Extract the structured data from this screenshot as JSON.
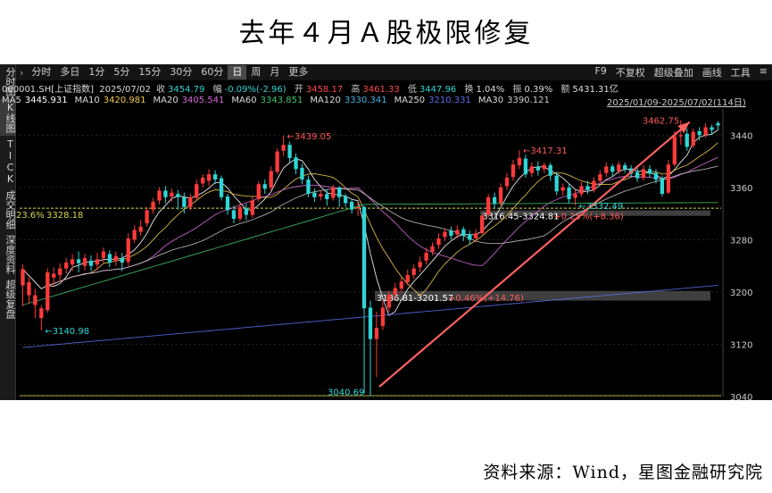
{
  "page": {
    "title": "去年４月Ａ股极限修复",
    "source": "资料来源：Wind，星图金融研究院"
  },
  "sidebar": {
    "items": [
      {
        "label": "分时图",
        "active": false
      },
      {
        "label": "K线图",
        "active": true
      },
      {
        "label": "TICK",
        "active": false
      },
      {
        "label": "成交明细",
        "active": false
      },
      {
        "label": "深度资料",
        "active": false
      },
      {
        "label": "超级复盘",
        "active": false
      }
    ]
  },
  "toolbar": {
    "arrow": "›",
    "periods": [
      {
        "label": "分时",
        "active": false
      },
      {
        "label": "多日",
        "active": false
      },
      {
        "label": "1分",
        "active": false
      },
      {
        "label": "5分",
        "active": false
      },
      {
        "label": "15分",
        "active": false
      },
      {
        "label": "30分",
        "active": false
      },
      {
        "label": "60分",
        "active": false
      },
      {
        "label": "日",
        "active": true
      },
      {
        "label": "周",
        "active": false
      },
      {
        "label": "月",
        "active": false
      },
      {
        "label": "更多",
        "active": false
      }
    ],
    "right_items": [
      "F9",
      "不复权",
      "超级叠加",
      "画线",
      "工具"
    ],
    "menu_icon": "≡"
  },
  "quote": {
    "code": "000001.SH[上证指数]",
    "date": "2025/07/02",
    "close_label": "收",
    "close": "3454.79",
    "change_label": "幅",
    "change": "-0.09%(-2.96)",
    "open_label": "开",
    "open": "3458.17",
    "high_label": "高",
    "high": "3461.33",
    "low_label": "低",
    "low": "3447.96",
    "turnover_label": "换",
    "turnover": "1.04%",
    "amplitude_label": "振",
    "amplitude": "0.39%",
    "amount_label": "额",
    "amount": "5431.31亿"
  },
  "ma_line": {
    "items": [
      {
        "name": "MA5",
        "value": "3445.931",
        "color": "#ffffff"
      },
      {
        "name": "MA10",
        "value": "3420.981",
        "color": "#f2c94c"
      },
      {
        "name": "MA20",
        "value": "3405.541",
        "color": "#d36bd8"
      },
      {
        "name": "MA60",
        "value": "3343.851",
        "color": "#3fc36b"
      },
      {
        "name": "MA120",
        "value": "3330.341",
        "color": "#42b4e6"
      },
      {
        "name": "MA250",
        "value": "3210.331",
        "color": "#5a6ee8"
      },
      {
        "name": "MA30",
        "value": "3390.121",
        "color": "#cfcfcf"
      }
    ],
    "range": "2025/01/09-2025/07/02(114日)"
  },
  "colors": {
    "up": "#ff3a3a",
    "down": "#2fd6d6",
    "annotation": "#ff5a5a",
    "arrow": "#ff6060",
    "fib_line": "#d8d84a",
    "grid": "#2a2a2a"
  },
  "chart_data": {
    "type": "candlestick",
    "ylim": [
      3040,
      3480
    ],
    "yticks": [
      3040,
      3120,
      3200,
      3280,
      3360,
      3440
    ],
    "candles": [
      [
        3210,
        3235,
        3178,
        3242
      ],
      [
        3195,
        3215,
        3182,
        3222
      ],
      [
        3180,
        3195,
        3160,
        3205
      ],
      [
        3160,
        3175,
        3140.98,
        3180
      ],
      [
        3172,
        3230,
        3168,
        3236
      ],
      [
        3222,
        3228,
        3208,
        3238
      ],
      [
        3226,
        3236,
        3215,
        3244
      ],
      [
        3236,
        3245,
        3228,
        3252
      ],
      [
        3242,
        3250,
        3232,
        3258
      ],
      [
        3250,
        3244,
        3230,
        3262
      ],
      [
        3240,
        3252,
        3233,
        3258
      ],
      [
        3248,
        3240,
        3232,
        3256
      ],
      [
        3242,
        3250,
        3234,
        3260
      ],
      [
        3252,
        3262,
        3245,
        3268
      ],
      [
        3258,
        3245,
        3238,
        3264
      ],
      [
        3247,
        3255,
        3240,
        3262
      ],
      [
        3252,
        3245,
        3232,
        3260
      ],
      [
        3246,
        3282,
        3240,
        3290
      ],
      [
        3280,
        3295,
        3275,
        3302
      ],
      [
        3292,
        3300,
        3286,
        3310
      ],
      [
        3305,
        3325,
        3300,
        3330
      ],
      [
        3326,
        3338,
        3320,
        3344
      ],
      [
        3340,
        3355,
        3334,
        3360
      ],
      [
        3355,
        3345,
        3336,
        3362
      ],
      [
        3346,
        3352,
        3338,
        3358
      ],
      [
        3350,
        3345,
        3326,
        3356
      ],
      [
        3345,
        3330,
        3320,
        3352
      ],
      [
        3330,
        3345,
        3325,
        3350
      ],
      [
        3344,
        3365,
        3340,
        3372
      ],
      [
        3366,
        3375,
        3360,
        3380
      ],
      [
        3370,
        3380,
        3362,
        3388
      ],
      [
        3380,
        3372,
        3365,
        3386
      ],
      [
        3374,
        3345,
        3340,
        3378
      ],
      [
        3346,
        3325,
        3318,
        3350
      ],
      [
        3325,
        3312,
        3305,
        3332
      ],
      [
        3312,
        3330,
        3308,
        3336
      ],
      [
        3328,
        3318,
        3310,
        3335
      ],
      [
        3318,
        3340,
        3314,
        3346
      ],
      [
        3342,
        3365,
        3338,
        3370
      ],
      [
        3365,
        3358,
        3350,
        3372
      ],
      [
        3360,
        3385,
        3355,
        3392
      ],
      [
        3384,
        3415,
        3380,
        3420
      ],
      [
        3416,
        3425,
        3408,
        3439.05
      ],
      [
        3425,
        3405,
        3398,
        3430
      ],
      [
        3406,
        3388,
        3380,
        3412
      ],
      [
        3390,
        3372,
        3365,
        3396
      ],
      [
        3372,
        3350,
        3345,
        3378
      ],
      [
        3352,
        3345,
        3338,
        3358
      ],
      [
        3346,
        3350,
        3340,
        3355
      ],
      [
        3350,
        3342,
        3332,
        3356
      ],
      [
        3344,
        3360,
        3340,
        3364
      ],
      [
        3360,
        3345,
        3330,
        3362
      ],
      [
        3346,
        3336,
        3330,
        3350
      ],
      [
        3338,
        3326,
        3320,
        3342
      ],
      [
        3328,
        3330,
        3316,
        3338
      ],
      [
        3330,
        3175,
        3045,
        3332
      ],
      [
        3176,
        3128,
        3040.69,
        3186.81
      ],
      [
        3128,
        3145,
        3070,
        3170
      ],
      [
        3148,
        3176,
        3142,
        3186
      ],
      [
        3176,
        3196,
        3170,
        3201.57
      ],
      [
        3196,
        3206,
        3190,
        3214
      ],
      [
        3205,
        3216,
        3200,
        3222
      ],
      [
        3215,
        3226,
        3210,
        3234
      ],
      [
        3226,
        3236,
        3220,
        3242
      ],
      [
        3238,
        3246,
        3230,
        3254
      ],
      [
        3248,
        3260,
        3242,
        3268
      ],
      [
        3262,
        3270,
        3256,
        3276
      ],
      [
        3272,
        3282,
        3266,
        3290
      ],
      [
        3284,
        3292,
        3278,
        3298
      ],
      [
        3294,
        3286,
        3280,
        3300
      ],
      [
        3288,
        3295,
        3282,
        3302
      ],
      [
        3296,
        3286,
        3278,
        3300
      ],
      [
        3288,
        3280,
        3272,
        3294
      ],
      [
        3282,
        3290,
        3276,
        3296
      ],
      [
        3290,
        3316.45,
        3288,
        3320
      ],
      [
        3318,
        3345,
        3314,
        3350
      ],
      [
        3345,
        3335,
        3328,
        3352
      ],
      [
        3336,
        3360,
        3332,
        3366
      ],
      [
        3362,
        3375,
        3356,
        3382
      ],
      [
        3376,
        3395,
        3370,
        3402
      ],
      [
        3394,
        3405,
        3388,
        3417.31
      ],
      [
        3404,
        3380,
        3375,
        3410
      ],
      [
        3382,
        3392,
        3376,
        3398
      ],
      [
        3392,
        3386,
        3378,
        3400
      ],
      [
        3388,
        3394,
        3382,
        3398
      ],
      [
        3394,
        3378,
        3370,
        3398
      ],
      [
        3378,
        3354,
        3348,
        3384
      ],
      [
        3355,
        3360,
        3348,
        3366
      ],
      [
        3360,
        3342,
        3336,
        3366
      ],
      [
        3344,
        3350,
        3332.49,
        3356
      ],
      [
        3350,
        3362,
        3346,
        3368
      ],
      [
        3362,
        3356,
        3350,
        3370
      ],
      [
        3356,
        3370,
        3352,
        3376
      ],
      [
        3370,
        3380,
        3366,
        3386
      ],
      [
        3382,
        3392,
        3376,
        3398
      ],
      [
        3392,
        3384,
        3376,
        3396
      ],
      [
        3385,
        3395,
        3380,
        3400
      ],
      [
        3394,
        3388,
        3382,
        3398
      ],
      [
        3389,
        3381,
        3376,
        3394
      ],
      [
        3383,
        3374,
        3368,
        3390
      ],
      [
        3375,
        3388,
        3370,
        3394
      ],
      [
        3388,
        3381,
        3375,
        3394
      ],
      [
        3382,
        3372,
        3366,
        3388
      ],
      [
        3374,
        3350,
        3346,
        3378
      ],
      [
        3352,
        3395,
        3350,
        3402
      ],
      [
        3395,
        3438,
        3392,
        3446
      ],
      [
        3438,
        3440,
        3425,
        3462.75
      ],
      [
        3442,
        3422,
        3416,
        3450
      ],
      [
        3424,
        3445,
        3420,
        3450
      ],
      [
        3446,
        3440,
        3432,
        3452
      ],
      [
        3440,
        3452,
        3436,
        3458
      ],
      [
        3452,
        3448,
        3440,
        3456
      ],
      [
        3458.17,
        3454.79,
        3447.96,
        3461.33
      ]
    ],
    "annotations": [
      {
        "text": "←3439.05",
        "x": 42,
        "y": 3439.05
      },
      {
        "text": "←3417.31",
        "x": 80,
        "y": 3417.31
      },
      {
        "text": "3462.75",
        "x": 105,
        "y": 3462.75
      },
      {
        "text": "←3140.98",
        "x": 3,
        "y": 3140.98
      },
      {
        "text": "←3332.49",
        "x": 89,
        "y": 3332.49
      },
      {
        "text": "3040.69",
        "x": 56,
        "y": 3040.69
      }
    ],
    "fib_label": {
      "pct": "23.6%",
      "value": "3328.18"
    },
    "gaps": [
      {
        "range": "3316.45-3324.81",
        "change": "+0.25%(+8.36)"
      },
      {
        "range": "3186.81-3201.57",
        "change": "+0.46%(+14.76)"
      }
    ],
    "series": [
      {
        "name": "MA5",
        "period": 5,
        "color": "#ffffff"
      },
      {
        "name": "MA10",
        "period": 10,
        "color": "#f2c94c"
      },
      {
        "name": "MA20",
        "period": 20,
        "color": "#d36bd8"
      },
      {
        "name": "MA30",
        "period": 30,
        "color": "#bfbfbf"
      },
      {
        "name": "MA60",
        "period": 60,
        "color": "#3fc36b"
      },
      {
        "name": "MA250",
        "period": 250,
        "color": "#5a6ee8"
      }
    ]
  }
}
